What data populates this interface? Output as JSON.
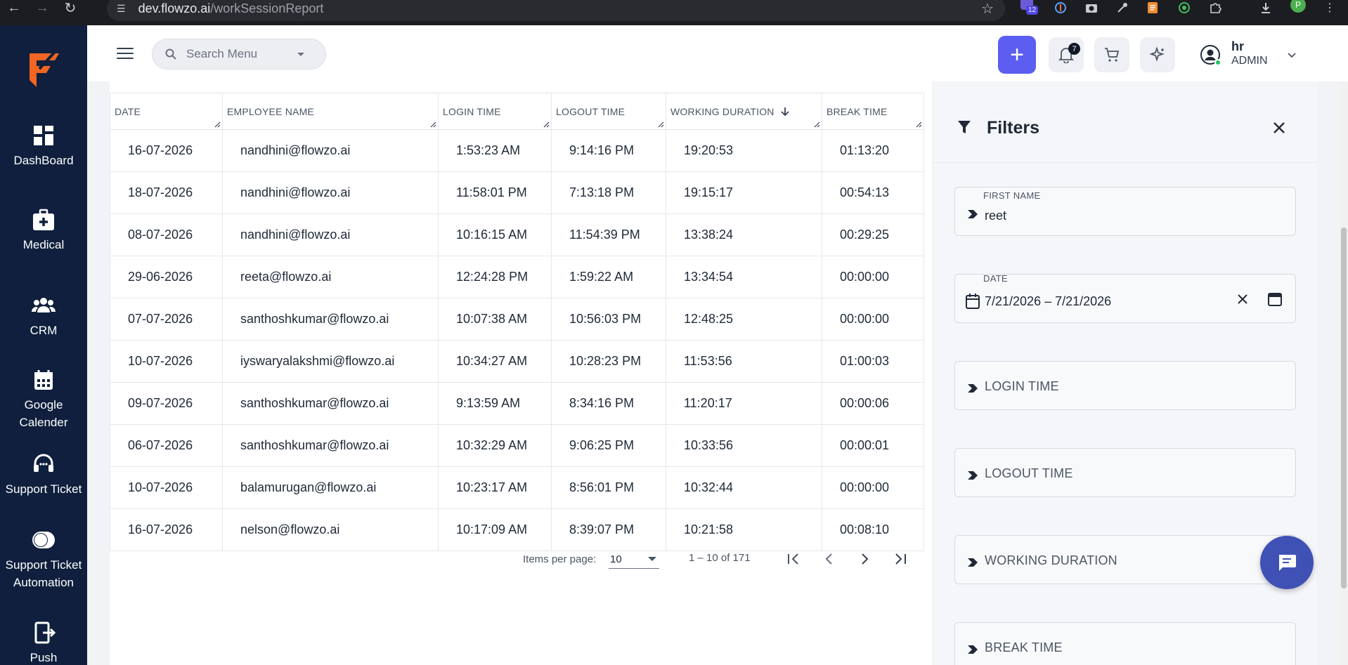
{
  "browser": {
    "url_host": "dev.flowzo.ai",
    "url_path": "/workSessionReport",
    "ext_badge": "12",
    "profile_initial": "P"
  },
  "sidebar": {
    "items": [
      {
        "label": "DashBoard",
        "icon": "dashboard-icon"
      },
      {
        "label": "Medical",
        "icon": "medical-kit-icon"
      },
      {
        "label": "CRM",
        "icon": "people-icon"
      },
      {
        "label": "Google Calender",
        "icon": "calendar-icon"
      },
      {
        "label": "Support Ticket",
        "icon": "headset-icon"
      },
      {
        "label": "Support Ticket Automation",
        "icon": "toggle-icon"
      },
      {
        "label": "Push",
        "icon": "exit-icon"
      }
    ]
  },
  "topbar": {
    "search_placeholder": "Search Menu",
    "notification_count": "7",
    "user_name": "hr",
    "user_role": "ADMIN"
  },
  "table": {
    "columns": [
      "DATE",
      "EMPLOYEE NAME",
      "LOGIN TIME",
      "LOGOUT TIME",
      "WORKING DURATION",
      "BREAK TIME"
    ],
    "rows": [
      [
        "16-07-2026",
        "nandhini@flowzo.ai",
        "1:53:23 AM",
        "9:14:16 PM",
        "19:20:53",
        "01:13:20"
      ],
      [
        "18-07-2026",
        "nandhini@flowzo.ai",
        "11:58:01 PM",
        "7:13:18 PM",
        "19:15:17",
        "00:54:13"
      ],
      [
        "08-07-2026",
        "nandhini@flowzo.ai",
        "10:16:15 AM",
        "11:54:39 PM",
        "13:38:24",
        "00:29:25"
      ],
      [
        "29-06-2026",
        "reeta@flowzo.ai",
        "12:24:28 PM",
        "1:59:22 AM",
        "13:34:54",
        "00:00:00"
      ],
      [
        "07-07-2026",
        "santhoshkumar@flowzo.ai",
        "10:07:38 AM",
        "10:56:03 PM",
        "12:48:25",
        "00:00:00"
      ],
      [
        "10-07-2026",
        "iyswaryalakshmi@flowzo.ai",
        "10:34:27 AM",
        "10:28:23 PM",
        "11:53:56",
        "01:00:03"
      ],
      [
        "09-07-2026",
        "santhoshkumar@flowzo.ai",
        "9:13:59 AM",
        "8:34:16 PM",
        "11:20:17",
        "00:00:06"
      ],
      [
        "06-07-2026",
        "santhoshkumar@flowzo.ai",
        "10:32:29 AM",
        "9:06:25 PM",
        "10:33:56",
        "00:00:01"
      ],
      [
        "10-07-2026",
        "balamurugan@flowzo.ai",
        "10:23:17 AM",
        "8:56:01 PM",
        "10:32:44",
        "00:00:00"
      ],
      [
        "16-07-2026",
        "nelson@flowzo.ai",
        "10:17:09 AM",
        "8:39:07 PM",
        "10:21:58",
        "00:08:10"
      ]
    ]
  },
  "paginator": {
    "label": "Items per page:",
    "page_size": "10",
    "range": "1 – 10 of 171"
  },
  "filters": {
    "title": "Filters",
    "first_name_label": "FIRST NAME",
    "first_name_value": "reet",
    "date_label": "DATE",
    "date_value": "7/21/2026 – 7/21/2026",
    "login_time": "LOGIN TIME",
    "logout_time": "LOGOUT TIME",
    "working_duration": "WORKING DURATION",
    "break_time": "BREAK TIME"
  },
  "colors": {
    "sidebar": "#0f1f3d",
    "accent": "#5b5ef0",
    "chat_fab": "#3f51b5",
    "logo": "#f26522"
  }
}
